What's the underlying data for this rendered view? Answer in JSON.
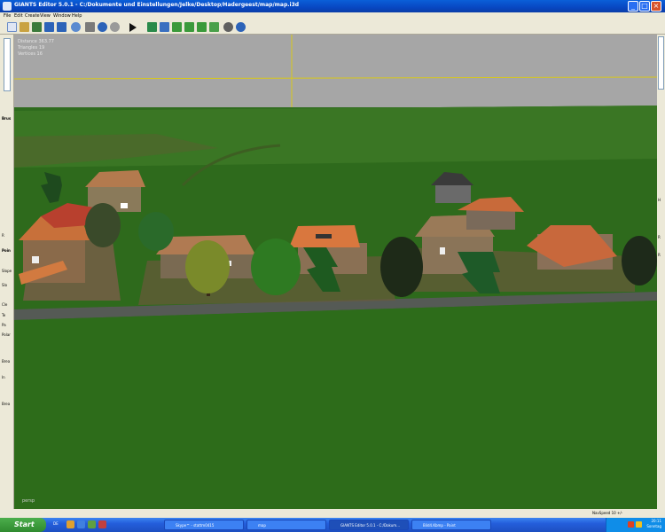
{
  "window": {
    "title": "GIANTS Editor 5.0.1 - C:/Dokumente und Einstellungen/Jelke/Desktop/Hadergeest/map/map.i3d"
  },
  "menu": [
    "File",
    "Edit",
    "Create",
    "View",
    "Window",
    "Help"
  ],
  "viewport": {
    "stats": {
      "distance": "Distance 363.77",
      "triangles": "Triangles 19",
      "vertices": "Vertices 16"
    },
    "camera_label": "persp"
  },
  "left_panel": [
    "Brus",
    "R",
    "Poin",
    "Slope",
    "Slo",
    "Cle",
    "Te",
    "Pa",
    "Polar",
    "Brea",
    "In",
    "Brea"
  ],
  "right_panel": [
    "H",
    "R",
    "R"
  ],
  "status": {
    "nav_speed": "NavSpeed 10 +/-"
  },
  "taskbar": {
    "start": "Start",
    "lang": "DE",
    "tasks": [
      "Skype™ - stattm0415",
      "map",
      "GIANTS Editor 5.0.1 - C:/Dokum...",
      "Bild4.Kbmp - Paint"
    ],
    "clock_time": "20:11",
    "clock_day": "Sonntag"
  }
}
